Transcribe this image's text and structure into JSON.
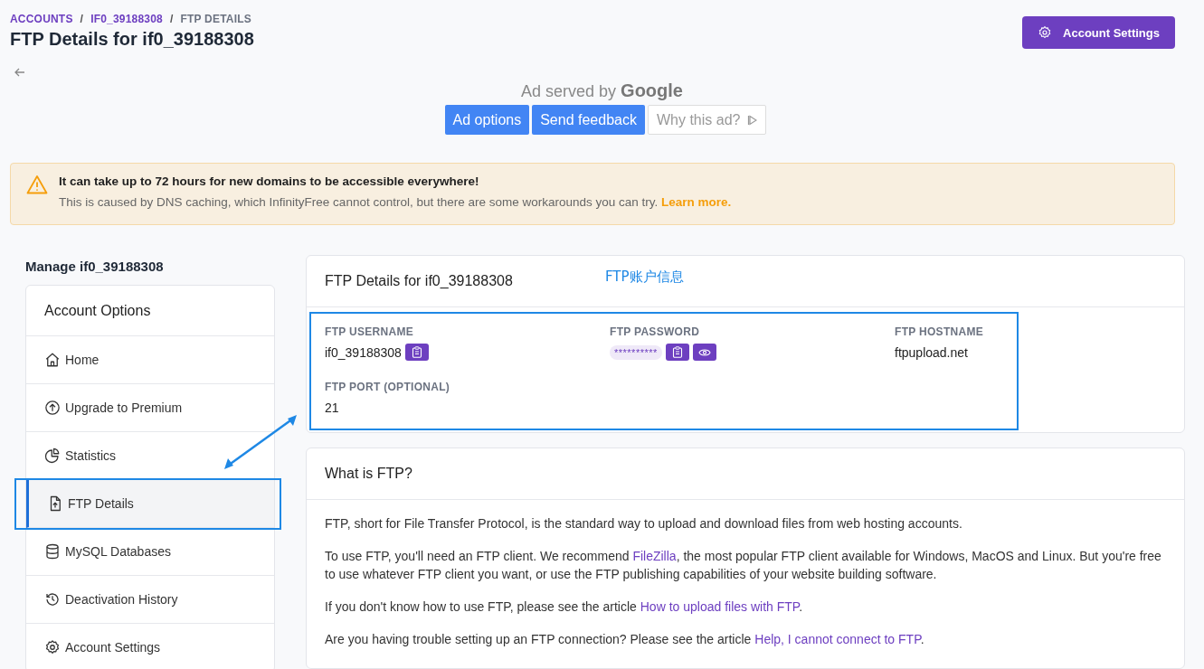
{
  "breadcrumb": [
    {
      "label": "ACCOUNTS",
      "kind": "link"
    },
    {
      "label": "IF0_39188308",
      "kind": "link"
    },
    {
      "label": "FTP DETAILS",
      "kind": "current"
    }
  ],
  "breadcrumb_separator": "/",
  "title": "FTP Details for if0_39188308",
  "header_button": "Account Settings",
  "ad": {
    "caption": "Ad served by",
    "brand": "Google",
    "buttons": [
      {
        "label": "Ad options",
        "kind": "primary"
      },
      {
        "label": "Send feedback",
        "kind": "primary"
      },
      {
        "label": "Why this ad?",
        "kind": "plain"
      }
    ]
  },
  "alert": {
    "title": "It can take up to 72 hours for new domains to be accessible everywhere!",
    "text": "This is caused by DNS caching, which InfinityFree cannot control, but there are some workarounds you can try.",
    "link": "Learn more."
  },
  "sidebar": {
    "heading": "Manage if0_39188308",
    "title": "Account Options",
    "items": [
      {
        "label": "Home",
        "selected": false
      },
      {
        "label": "Upgrade to Premium",
        "selected": false
      },
      {
        "label": "Statistics",
        "selected": false
      },
      {
        "label": "FTP Details",
        "selected": true
      },
      {
        "label": "MySQL Databases",
        "selected": false
      },
      {
        "label": "Deactivation History",
        "selected": false
      },
      {
        "label": "Account Settings",
        "selected": false
      }
    ]
  },
  "details_card": {
    "title": "FTP Details for if0_39188308",
    "fields": [
      {
        "label": "FTP USERNAME",
        "value": "if0_39188308",
        "kind": "copy"
      },
      {
        "label": "FTP PASSWORD",
        "value": "**********",
        "kind": "secret"
      },
      {
        "label": "FTP HOSTNAME",
        "value": "ftpupload.net",
        "kind": "text"
      },
      {
        "label": "FTP PORT (OPTIONAL)",
        "value": "21",
        "kind": "text"
      }
    ]
  },
  "info_card": {
    "title": "What is FTP?",
    "paragraphs": [
      [
        {
          "text": "FTP, short for File Transfer Protocol, is the standard way to upload and download files from web hosting accounts.",
          "kind": "text"
        }
      ],
      [
        {
          "text": "To use FTP, you'll need an FTP client. We recommend ",
          "kind": "text"
        },
        {
          "text": "FileZilla",
          "kind": "link"
        },
        {
          "text": ", the most popular FTP client available for Windows, MacOS and Linux. But you're free to use whatever FTP client you want, or use the FTP publishing capabilities of your website building software.",
          "kind": "text"
        }
      ],
      [
        {
          "text": "If you don't know how to use FTP, please see the article ",
          "kind": "text"
        },
        {
          "text": "How to upload files with FTP",
          "kind": "link"
        },
        {
          "text": ".",
          "kind": "text"
        }
      ],
      [
        {
          "text": "Are you having trouble setting up an FTP connection? Please see the article ",
          "kind": "text"
        },
        {
          "text": "Help, I cannot connect to FTP",
          "kind": "link"
        },
        {
          "text": ".",
          "kind": "text"
        }
      ]
    ]
  },
  "annotation": {
    "label": "FTP账户信息"
  }
}
